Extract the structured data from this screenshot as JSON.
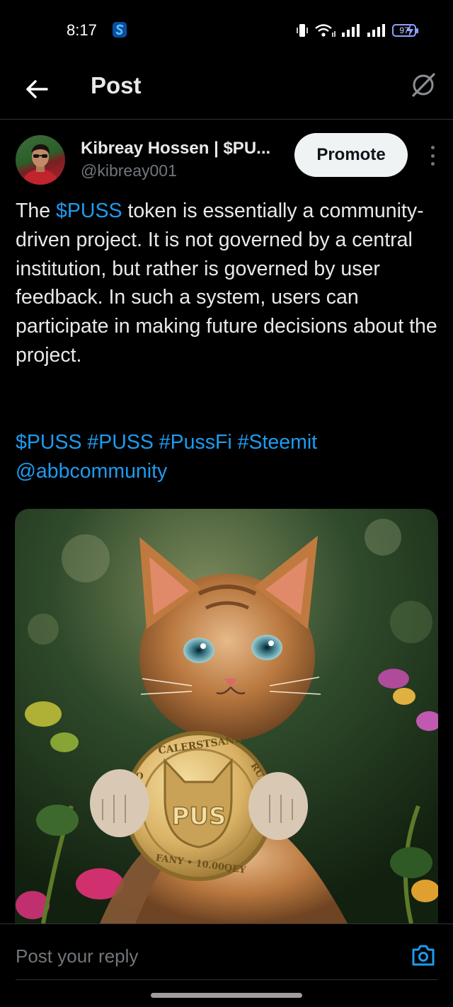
{
  "status_bar": {
    "time": "8:17",
    "app_icon": "s-logo-icon",
    "battery": "97",
    "icons": [
      "vibrate-icon",
      "wifi-icon",
      "signal-icon",
      "signal-icon",
      "battery-icon",
      "charging-icon"
    ]
  },
  "header": {
    "title": "Post",
    "back_icon": "back-arrow-icon",
    "right_icon": "grok-icon"
  },
  "post": {
    "author_name": "Kibreay Hossen | $PU...",
    "author_handle": "@kibreay001",
    "promote_label": "Promote",
    "text_before": "The ",
    "text_link": "$PUSS",
    "text_after": " token is essentially a community-driven project. It is not governed by a central institution, but rather is governed by user feedback. In such a system, users can participate in making future decisions about the project.",
    "tags_line1": "$PUSS #PUSS #PussFi #Steemit",
    "tags_line2": "@abbcommunity",
    "media": {
      "coin_text_top": "CALERSTSANS",
      "coin_text_right": "RUET",
      "coin_text_left": "O",
      "coin_text_center": "PUS",
      "coin_text_bottom": "FANY • 10.00QEY"
    }
  },
  "reply": {
    "placeholder": "Post your reply",
    "camera_icon": "camera-icon"
  },
  "colors": {
    "link": "#1d9bf0",
    "background": "#000000",
    "muted": "#71767b"
  }
}
